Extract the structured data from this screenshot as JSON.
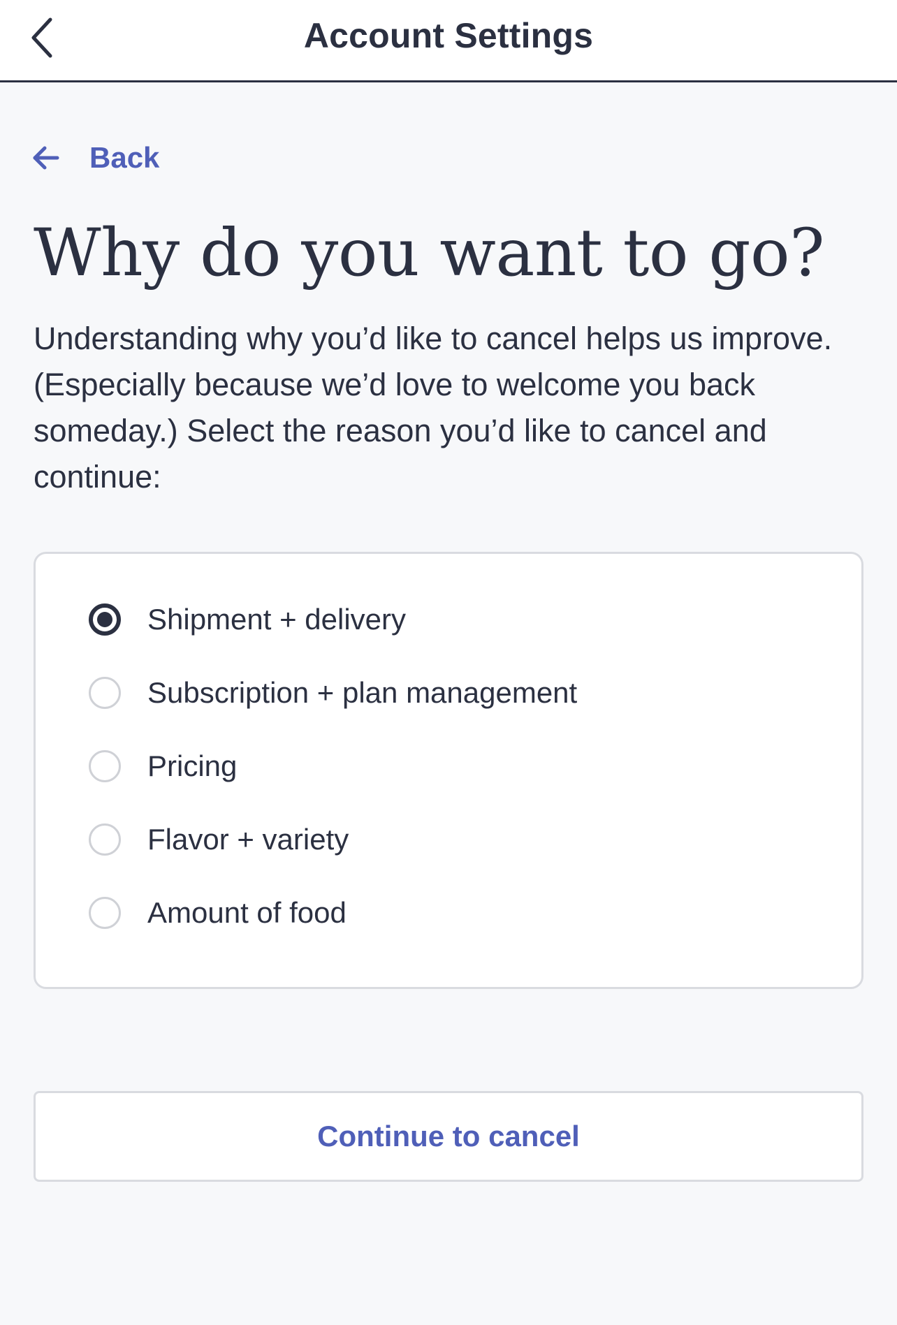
{
  "header": {
    "title": "Account Settings",
    "back_icon": "chevron-left-icon"
  },
  "back_link": {
    "label": "Back",
    "icon": "arrow-left-icon"
  },
  "page": {
    "title": "Why do you want to go?",
    "description": "Understanding why you’d like to cancel helps us improve. (Especially because we’d love to welcome you back someday.) Select the reason you’d like to cancel and continue:"
  },
  "reasons": {
    "selected_index": 0,
    "options": [
      {
        "label": "Shipment + delivery",
        "selected": true
      },
      {
        "label": "Subscription + plan management",
        "selected": false
      },
      {
        "label": "Pricing",
        "selected": false
      },
      {
        "label": "Flavor + variety",
        "selected": false
      },
      {
        "label": "Amount of food",
        "selected": false
      }
    ]
  },
  "actions": {
    "continue_label": "Continue to cancel"
  },
  "colors": {
    "text": "#2b3041",
    "accent": "#4f5fb8",
    "background": "#f7f8fa",
    "border": "#d9dbe0"
  }
}
